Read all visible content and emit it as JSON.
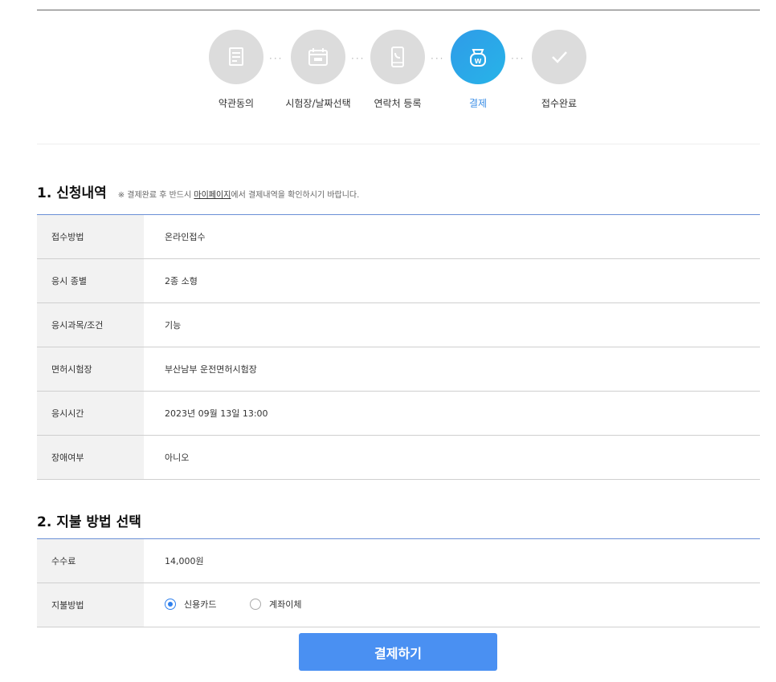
{
  "steps": [
    {
      "label": "약관동의",
      "icon": "document-icon",
      "active": false
    },
    {
      "label": "시험장/날짜선택",
      "icon": "calendar-icon",
      "active": false
    },
    {
      "label": "연락처 등록",
      "icon": "phone-icon",
      "active": false
    },
    {
      "label": "결제",
      "icon": "payment-bag-icon",
      "active": true
    },
    {
      "label": "접수완료",
      "icon": "checkmark-icon",
      "active": false
    }
  ],
  "section1": {
    "title": "1. 신청내역",
    "note_prefix": "※ 결제완료 후 반드시 ",
    "note_link": "마이페이지",
    "note_suffix": "에서 결제내역을 확인하시기 바랍니다.",
    "rows": [
      {
        "label": "접수방법",
        "value": "온라인접수"
      },
      {
        "label": "응시 종별",
        "value": "2종 소형"
      },
      {
        "label": "응시과목/조건",
        "value": "기능"
      },
      {
        "label": "면허시험장",
        "value": "부산남부 운전면허시험장"
      },
      {
        "label": "응시시간",
        "value": "2023년 09월 13일 13:00"
      },
      {
        "label": "장애여부",
        "value": "아니오"
      }
    ]
  },
  "section2": {
    "title": "2. 지불 방법 선택",
    "fee_label": "수수료",
    "fee_value": "14,000원",
    "method_label": "지불방법",
    "options": [
      {
        "label": "신용카드",
        "selected": true
      },
      {
        "label": "계좌이체",
        "selected": false
      }
    ]
  },
  "pay_button": "결제하기",
  "colors": {
    "accent": "#4a90f2",
    "active_step": "#2f9be8",
    "inactive_step": "#dcdcdc"
  }
}
